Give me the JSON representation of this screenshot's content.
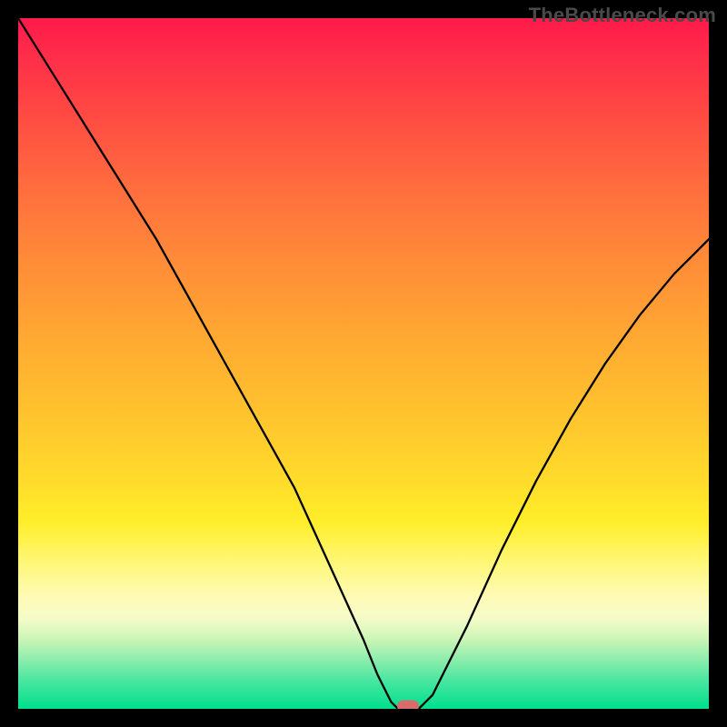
{
  "watermark": "TheBottleneck.com",
  "chart_data": {
    "type": "line",
    "title": "",
    "xlabel": "",
    "ylabel": "",
    "xlim": [
      0,
      100
    ],
    "ylim": [
      0,
      100
    ],
    "grid": false,
    "legend": false,
    "series": [
      {
        "name": "bottleneck-curve",
        "x": [
          0,
          5,
          10,
          15,
          20,
          25,
          30,
          35,
          40,
          45,
          50,
          52,
          54,
          55,
          58,
          60,
          62,
          65,
          70,
          75,
          80,
          85,
          90,
          95,
          100
        ],
        "values": [
          100,
          92,
          84,
          76,
          68,
          59,
          50,
          41,
          32,
          21,
          10,
          5,
          1,
          0,
          0,
          2,
          6,
          12,
          23,
          33,
          42,
          50,
          57,
          63,
          68
        ]
      }
    ],
    "marker": {
      "x": 56.5,
      "y": 0
    },
    "background_gradient": {
      "stops": [
        {
          "pos": 0,
          "color": "#ff1a4b"
        },
        {
          "pos": 35,
          "color": "#ff8b38"
        },
        {
          "pos": 66,
          "color": "#ffd92b"
        },
        {
          "pos": 85,
          "color": "#fffbb8"
        },
        {
          "pos": 100,
          "color": "#00e08d"
        }
      ]
    }
  }
}
